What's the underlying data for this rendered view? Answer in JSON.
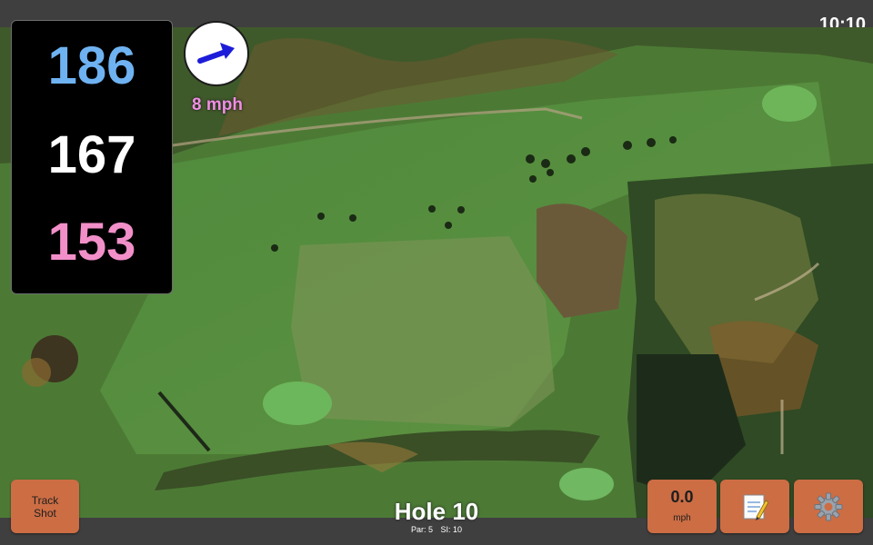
{
  "status_bar": {
    "time": "10:10"
  },
  "distances": {
    "back": "186",
    "middle": "167",
    "front": "153",
    "colors": {
      "back": "#6fb2f2",
      "middle": "#ffffff",
      "front": "#f28fc9"
    }
  },
  "wind": {
    "speed": "8 mph",
    "color": "#f08ee2",
    "arrow_icon": "wind-direction-arrow-icon",
    "arrow_color": "#1d1dd9"
  },
  "hole": {
    "title": "Hole 10",
    "par_label": "Par: 5",
    "si_label": "SI: 10"
  },
  "buttons": {
    "track_shot_line1": "Track",
    "track_shot_line2": "Shot",
    "speed_value": "0.0",
    "speed_unit": "mph",
    "notes_icon": "notepad-icon",
    "settings_icon": "gear-icon",
    "color": "#cc6d44"
  }
}
